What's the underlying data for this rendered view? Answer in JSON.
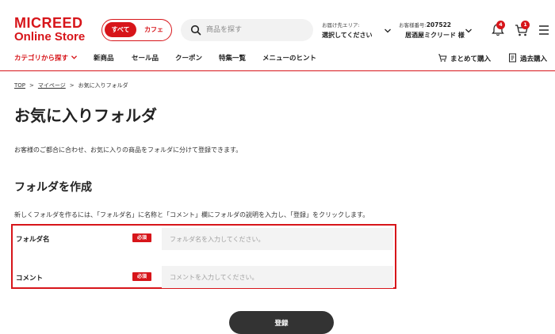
{
  "logo": {
    "line1": "MICREED",
    "line2": "Online Store"
  },
  "store_toggle": {
    "all": "すべて",
    "cafe": "カフェ"
  },
  "search": {
    "placeholder": "商品を探す"
  },
  "delivery": {
    "label": "お届け先エリア:",
    "value": "選択してください"
  },
  "customer": {
    "label": "お客様番号:",
    "number": "207522",
    "name": "居酒屋ミクリード 様"
  },
  "notifications": {
    "count": "4"
  },
  "cart": {
    "count": "1"
  },
  "nav": {
    "category": "カテゴリから探す",
    "items": [
      "新商品",
      "セール品",
      "クーポン",
      "特集一覧",
      "メニューのヒント"
    ],
    "bulk_buy": "まとめて購入",
    "past_buy": "過去購入"
  },
  "breadcrumb": [
    "TOP",
    "マイページ",
    "お気に入りフォルダ"
  ],
  "page": {
    "title": "お気に入りフォルダ",
    "description": "お客様のご都合に合わせ、お気に入りの商品をフォルダに分けて登録できます。",
    "section_title": "フォルダを作成",
    "section_description": "新しくフォルダを作るには、「フォルダ名」に名称と「コメント」欄にフォルダの説明を入力し、「登録」をクリックします。"
  },
  "form": {
    "required_badge": "必須",
    "folder_name": {
      "label": "フォルダ名",
      "placeholder": "フォルダ名を入力してください。"
    },
    "comment": {
      "label": "コメント",
      "placeholder": "コメントを入力してください。"
    },
    "submit": "登録"
  },
  "colors": {
    "brand": "#d7151a",
    "button": "#333333",
    "input_bg": "#f3f3f3"
  }
}
